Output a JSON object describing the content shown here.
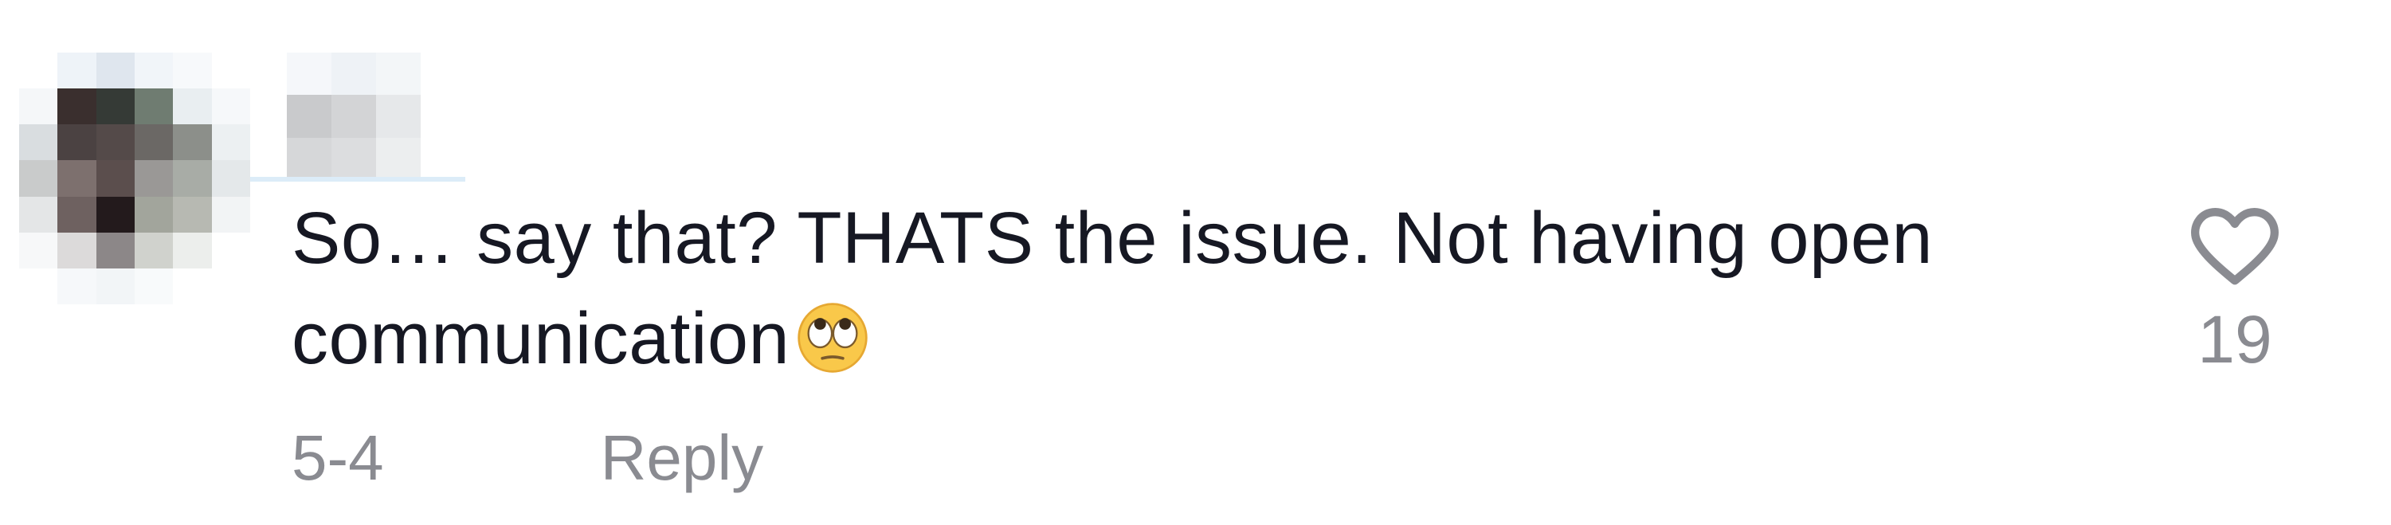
{
  "comment": {
    "text": "So… say that? THATS the issue. Not having open communication",
    "emoji": "face-with-rolling-eyes",
    "date": "5-4",
    "reply_label": "Reply",
    "like_count": "19",
    "like_icon": "heart-outline-icon",
    "avatar": "pixelated-avatar",
    "username": "pixelated-username"
  },
  "colors": {
    "text": "#161823",
    "secondary": "#8a8b91",
    "background": "#ffffff"
  }
}
